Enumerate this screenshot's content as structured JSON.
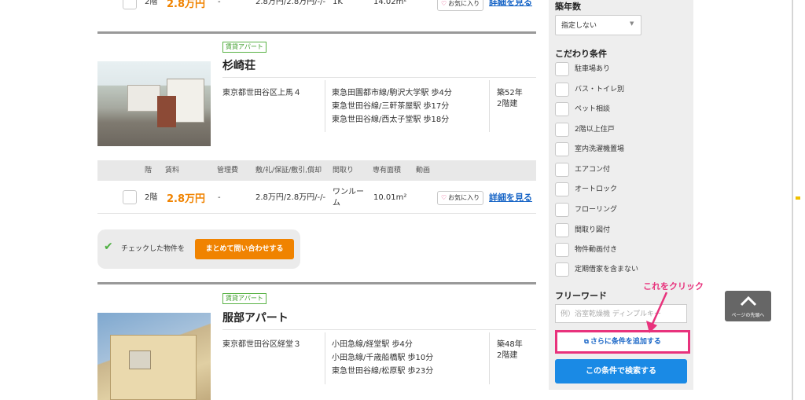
{
  "top_row": {
    "floor": "2階",
    "rent": "2.8万円",
    "admin_fee": "-",
    "deposit": "2.8万円/2.8万円/-/-",
    "layout": "1K",
    "area": "14.02m²",
    "fav": "お気に入り",
    "detail": "詳細を見る"
  },
  "listing1": {
    "badge": "賃貸アパート",
    "name": "杉崎荘",
    "address": "東京都世田谷区上馬４",
    "stations": [
      "東急田園都市線/駒沢大学駅 歩4分",
      "東急世田谷線/三軒茶屋駅 歩17分",
      "東急世田谷線/西太子堂駅 歩18分"
    ],
    "age": "築52年",
    "floors": "2階建",
    "headers": [
      "階",
      "賃料",
      "管理費",
      "敷/礼/保証/敷引,償却",
      "間取り",
      "専有面積",
      "動画"
    ],
    "row": {
      "floor": "2階",
      "rent": "2.8万円",
      "admin_fee": "-",
      "deposit": "2.8万円/2.8万円/-/-",
      "layout_line1": "ワンルー",
      "layout_line2": "ム",
      "area": "10.01m²",
      "fav": "お気に入り",
      "detail": "詳細を見る"
    }
  },
  "inquiry": {
    "text": "チェックした物件を",
    "button": "まとめて問い合わせする"
  },
  "listing2": {
    "badge": "賃貸アパート",
    "name": "服部アパート",
    "address": "東京都世田谷区経堂３",
    "stations": [
      "小田急線/経堂駅 歩4分",
      "小田急線/千歳船橋駅 歩10分",
      "東急世田谷線/松原駅 歩23分"
    ],
    "age": "築48年",
    "floors": "2階建"
  },
  "sidebar": {
    "age_heading": "築年数",
    "age_select": "指定しない",
    "cond_heading": "こだわり条件",
    "conditions": [
      "駐車場あり",
      "バス・トイレ別",
      "ペット相談",
      "2階以上住戸",
      "室内洗濯機置場",
      "エアコン付",
      "オートロック",
      "フローリング",
      "間取り図付",
      "物件動画付き",
      "定期借家を含まない"
    ],
    "free_heading": "フリーワード",
    "free_placeholder": "例）浴室乾燥機 ディンプルキー",
    "add_cond": "さらに条件を追加する",
    "search": "この条件で検索する"
  },
  "annotation": {
    "text": "これをクリック",
    "color": "#e8327c"
  },
  "page_top": {
    "label": "ページの先頭へ"
  },
  "colors": {
    "accent_orange": "#f08300",
    "link_blue": "#1664c6",
    "search_blue": "#1a8ae5",
    "highlight_pink": "#e8327c"
  }
}
